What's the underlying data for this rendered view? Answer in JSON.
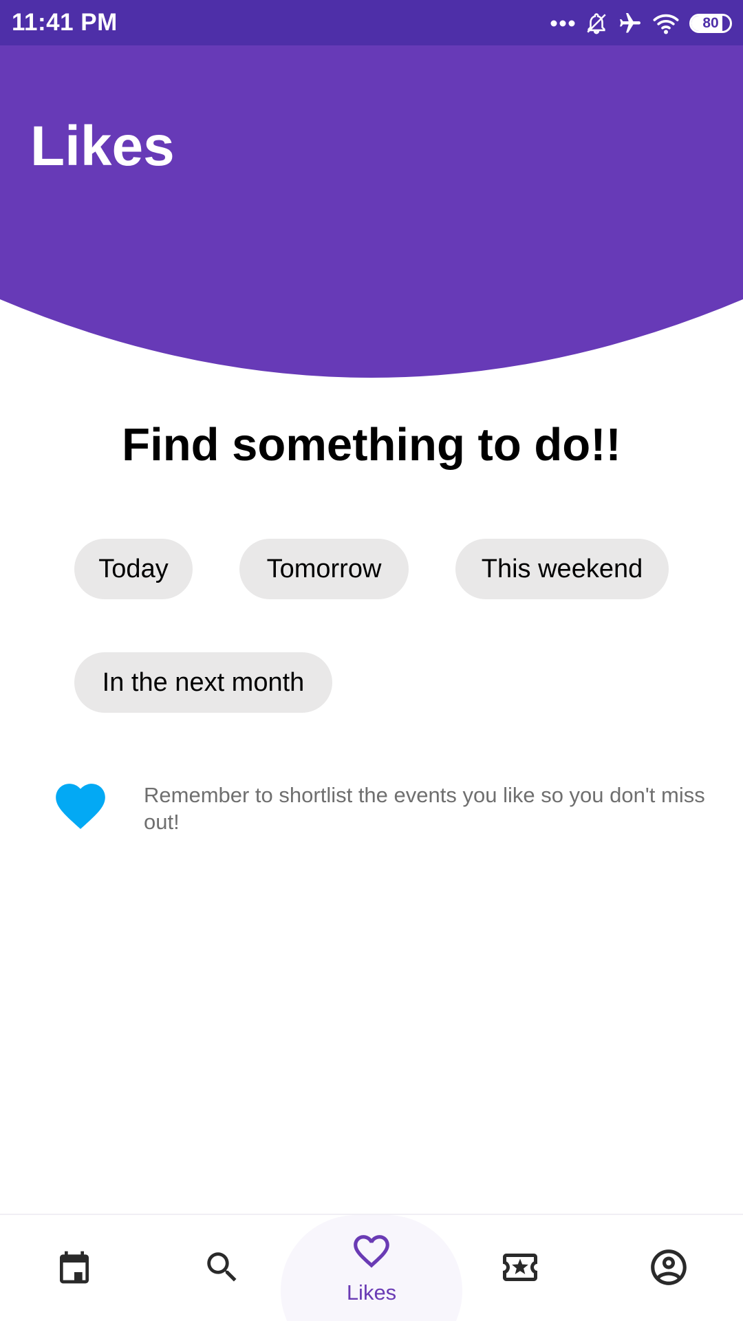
{
  "status_bar": {
    "time": "11:41 PM",
    "battery": "80",
    "battery_level": 0.8,
    "icons": [
      "more-dots-icon",
      "bell-off-icon",
      "airplane-icon",
      "wifi-icon",
      "battery-icon"
    ]
  },
  "header": {
    "title": "Likes",
    "background_color": "#673ab7"
  },
  "main": {
    "headline": "Find something to do!!",
    "chips": [
      {
        "label": "Today"
      },
      {
        "label": "Tomorrow"
      },
      {
        "label": "This weekend"
      },
      {
        "label": "In the next month"
      }
    ],
    "tip": {
      "icon": "heart-icon",
      "icon_color": "#03a9f4",
      "text": "Remember to shortlist the events you like so you don't miss out!"
    }
  },
  "bottom_nav": {
    "accent_color": "#6a3bb4",
    "items": [
      {
        "icon": "calendar-icon",
        "label": ""
      },
      {
        "icon": "search-icon",
        "label": ""
      },
      {
        "icon": "heart-outline-icon",
        "label": "Likes",
        "active": true
      },
      {
        "icon": "ticket-star-icon",
        "label": ""
      },
      {
        "icon": "account-circle-icon",
        "label": ""
      }
    ]
  }
}
